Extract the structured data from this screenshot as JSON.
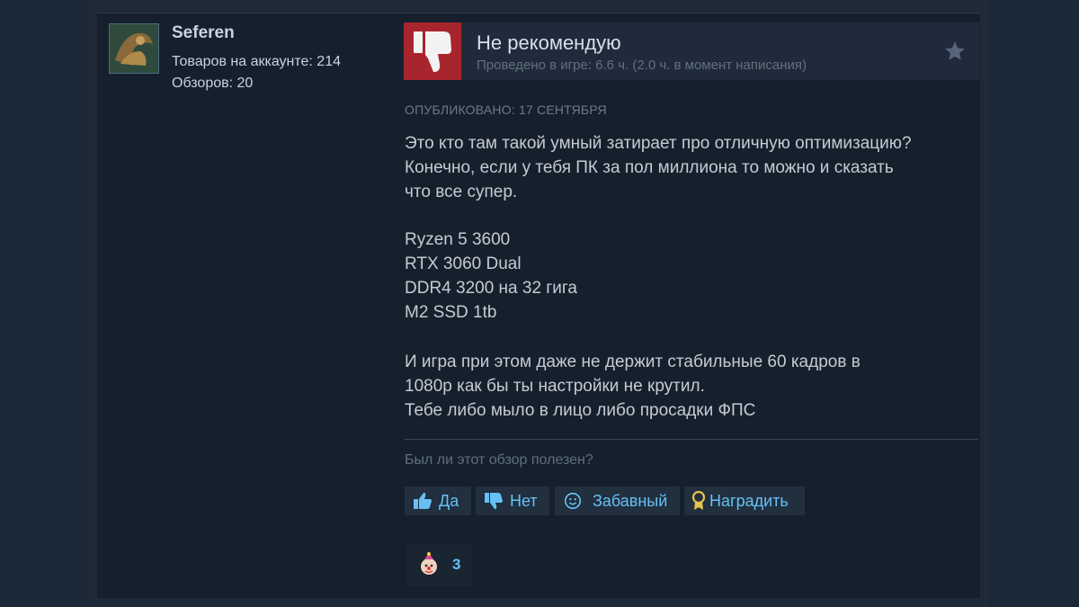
{
  "reviewer": {
    "name": "Seferen",
    "products_label": "Товаров на аккаунте: 214",
    "reviews_label": "Обзоров: 20"
  },
  "review": {
    "verdict": "Не рекомендую",
    "playtime": "Проведено в игре: 6.6 ч. (2.0 ч. в момент написания)",
    "posted": "ОПУБЛИКОВАНО: 17 СЕНТЯБРЯ",
    "paragraphs": [
      [
        "Это кто там такой умный затирает про отличную оптимизацию?",
        "Конечно, если у тебя ПК за пол миллиона то можно и сказать",
        "что все супер."
      ],
      [
        "Ryzen 5 3600",
        "RTX 3060 Dual",
        "DDR4 3200 на 32 гига",
        "M2 SSD 1tb"
      ],
      [
        "И игра при этом даже не держит стабильные 60 кадров в",
        "1080p как бы ты настройки не крутил.",
        "Тебе либо мыло в лицо либо просадки ФПС"
      ]
    ]
  },
  "helpful": {
    "question": "Был ли этот обзор полезен?",
    "yes": "Да",
    "no": "Нет",
    "funny": "Забавный",
    "award": "Наградить"
  },
  "awards": {
    "count": "3"
  },
  "colors": {
    "thumb_down_bg": "#a9252d",
    "link_blue": "#66c0f4"
  }
}
